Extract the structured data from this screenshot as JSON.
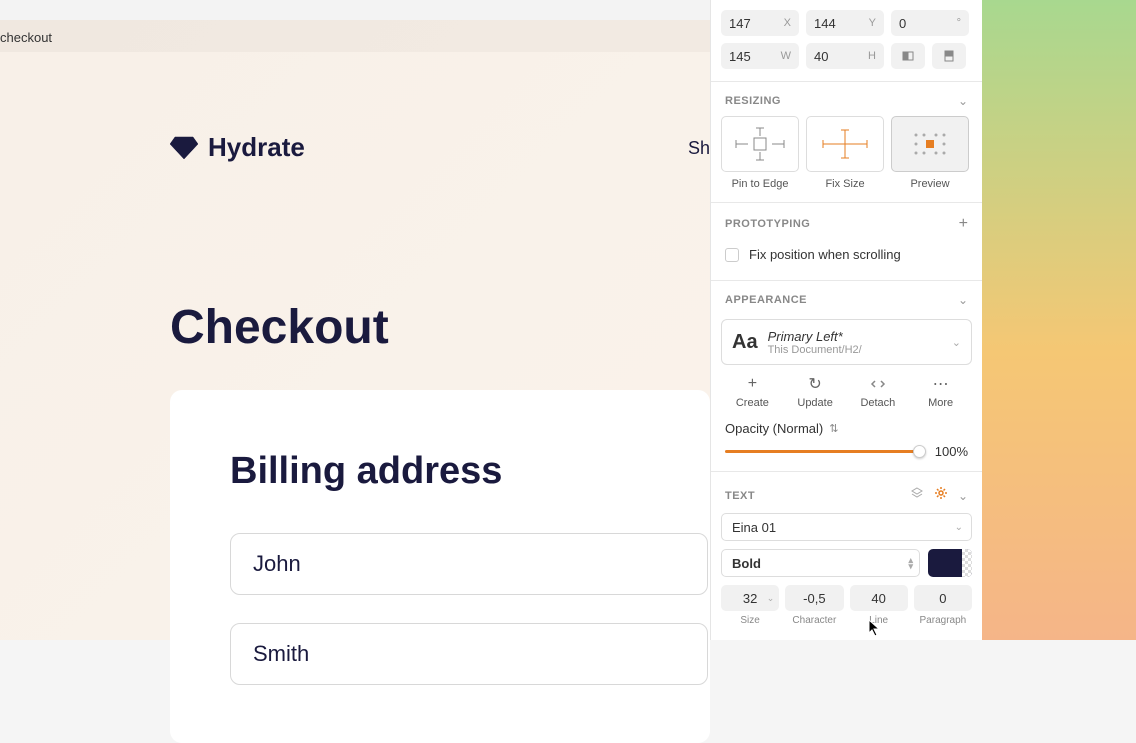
{
  "tab": {
    "name": "checkout"
  },
  "canvas": {
    "brand": "Hydrate",
    "nav_link": "Sh",
    "page_title": "Checkout",
    "form_heading": "Billing address",
    "first_name": "John",
    "last_name": "Smith"
  },
  "transform": {
    "x": "147",
    "x_label": "X",
    "y": "144",
    "y_label": "Y",
    "rotation": "0",
    "rotation_label": "°",
    "w": "145",
    "w_label": "W",
    "h": "40",
    "h_label": "H"
  },
  "resizing": {
    "title": "RESIZING",
    "pin": "Pin to Edge",
    "fix": "Fix Size",
    "preview": "Preview"
  },
  "prototyping": {
    "title": "PROTOTYPING",
    "fix_scroll": "Fix position when scrolling"
  },
  "appearance": {
    "title": "APPEARANCE",
    "style_name": "Primary Left*",
    "style_path": "This Document/H2/",
    "create": "Create",
    "update": "Update",
    "detach": "Detach",
    "more": "More",
    "opacity_label": "Opacity (Normal)",
    "opacity_value": "100%"
  },
  "text": {
    "title": "TEXT",
    "font": "Eina 01",
    "weight": "Bold",
    "size": "32",
    "character": "-0,5",
    "line": "40",
    "paragraph": "0",
    "size_label": "Size",
    "character_label": "Character",
    "line_label": "Line",
    "paragraph_label": "Paragraph",
    "color": "#1a1a3e"
  }
}
